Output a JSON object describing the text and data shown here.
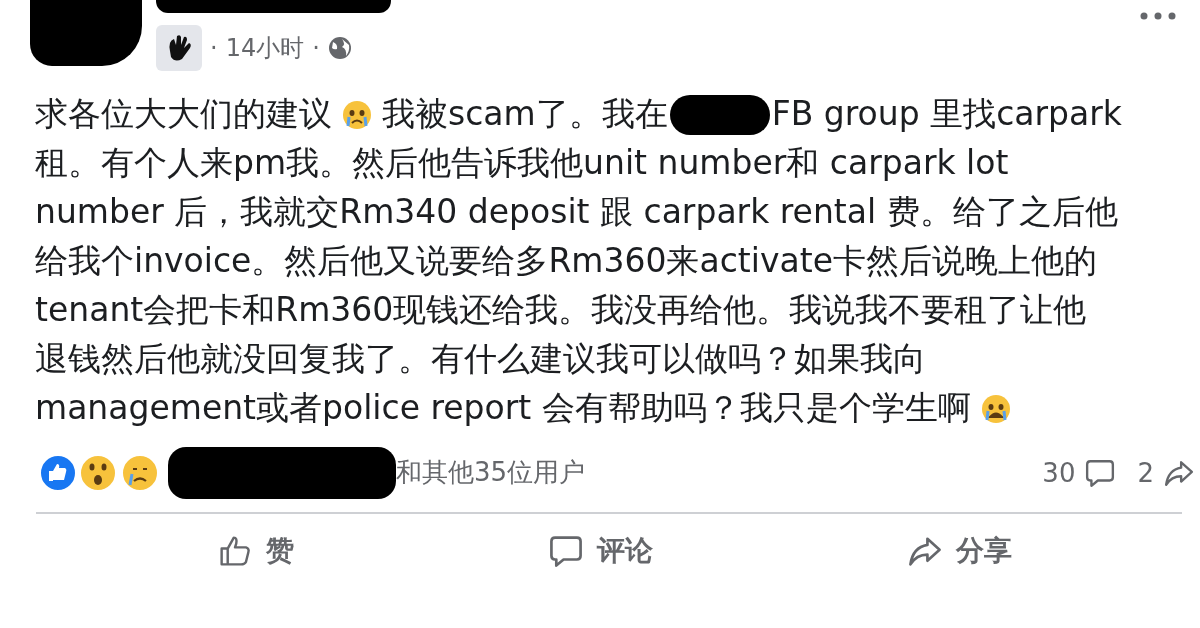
{
  "post": {
    "separator": "·",
    "time": "14小时",
    "body_lines": [
      [
        {
          "kind": "text",
          "text": "求各位大大们的建议"
        },
        {
          "kind": "emoji"
        },
        {
          "kind": "text",
          "text": "我被scam了。我在"
        },
        {
          "kind": "redaction"
        },
        {
          "kind": "text",
          "text": "FB group 里找carpark"
        }
      ],
      [
        {
          "kind": "text",
          "text": "租。有个人来pm我。然后他告诉我他unit number和 carpark lot"
        }
      ],
      [
        {
          "kind": "text",
          "text": "number 后，我就交Rm340 deposit 跟 carpark rental 费。给了之后他"
        }
      ],
      [
        {
          "kind": "text",
          "text": "给我个invoice。然后他又说要给多Rm360来activate卡然后说晚上他的"
        }
      ],
      [
        {
          "kind": "text",
          "text": "tenant会把卡和Rm360现钱还给我。我没再给他。我说我不要租了让他"
        }
      ],
      [
        {
          "kind": "text",
          "text": "退钱然后他就没回复我了。有什么建议我可以做吗？如果我向"
        }
      ],
      [
        {
          "kind": "text",
          "text": "management或者police report 会有帮助吗？我只是个学生啊"
        },
        {
          "kind": "emoji"
        }
      ]
    ],
    "reactions_text": "和其他35位用户",
    "comments_count": "30",
    "shares_count": "2",
    "actions": [
      {
        "kind": "like",
        "label": "赞"
      },
      {
        "kind": "comment",
        "label": "评论"
      },
      {
        "kind": "share",
        "label": "分享"
      }
    ]
  }
}
